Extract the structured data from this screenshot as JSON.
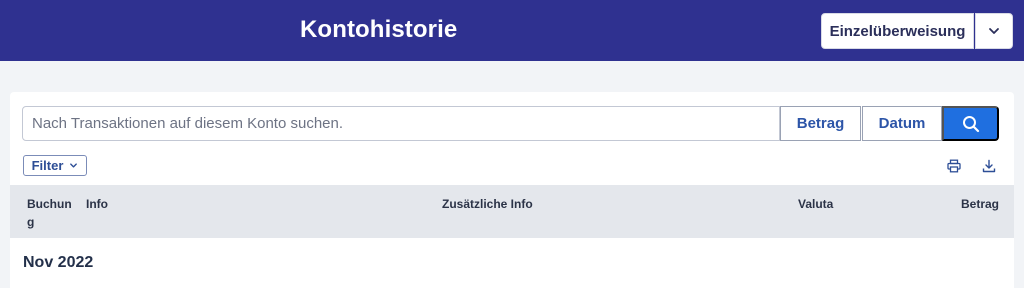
{
  "header": {
    "title": "Kontohistorie",
    "action_button": "Einzelüberweisung"
  },
  "search": {
    "placeholder": "Nach Transaktionen auf diesem Konto suchen.",
    "betrag_label": "Betrag",
    "datum_label": "Datum"
  },
  "toolbar": {
    "filter_label": "Filter"
  },
  "table": {
    "columns": [
      "Buchung",
      "Info",
      "Zusätzliche Info",
      "Valuta",
      "Betrag"
    ]
  },
  "groups": [
    {
      "month": "Nov 2022"
    }
  ],
  "colors": {
    "header_bg": "#2f3190",
    "primary_blue": "#1f6fe0",
    "table_header_bg": "#e4e7ec"
  }
}
